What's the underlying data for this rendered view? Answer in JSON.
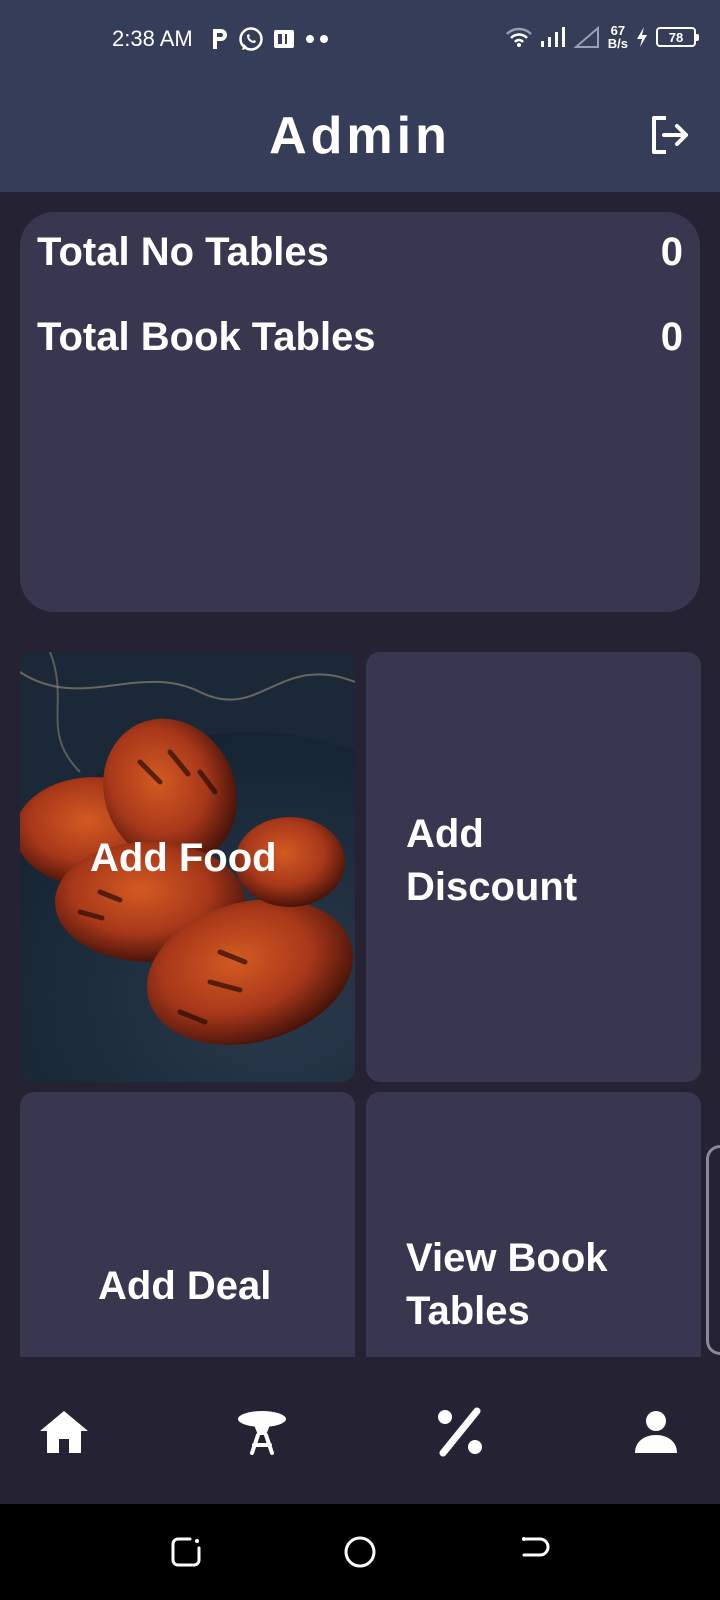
{
  "status_bar": {
    "time": "2:38 AM",
    "net_speed_value": "67",
    "net_speed_unit": "B/s",
    "battery": "78",
    "icons": [
      "parking-icon",
      "whatsapp-icon",
      "app-icon",
      "more-dots-icon",
      "wifi-icon",
      "signal-icon",
      "signal-empty-icon",
      "charging-icon",
      "battery-icon"
    ]
  },
  "header": {
    "title": "Admin",
    "logout_icon": "logout-icon"
  },
  "stats": {
    "total_tables_label": "Total No Tables",
    "total_tables_value": "0",
    "booked_tables_label": "Total Book Tables",
    "booked_tables_value": "0"
  },
  "tiles": {
    "add_food": "Add Food",
    "add_discount_line1": "Add",
    "add_discount_line2": "Discount",
    "add_deal": "Add Deal",
    "view_book_line1": "View Book",
    "view_book_line2": "Tables"
  },
  "bottom_nav": {
    "items": [
      "home-icon",
      "table-icon",
      "percent-icon",
      "person-icon"
    ]
  },
  "system_nav": {
    "items": [
      "recents-icon",
      "home-circle-icon",
      "back-icon"
    ]
  },
  "colors": {
    "header_bg": "#363d58",
    "page_bg": "#252333",
    "card_bg": "#393750",
    "text": "#ffffff"
  }
}
